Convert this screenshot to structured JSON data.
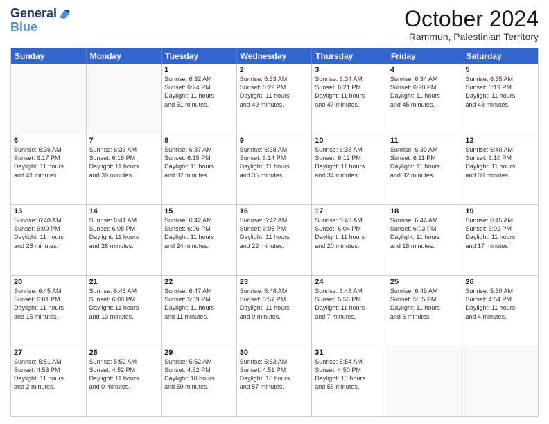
{
  "logo": {
    "line1": "General",
    "line2": "Blue"
  },
  "title": "October 2024",
  "location": "Rammun, Palestinian Territory",
  "days_of_week": [
    "Sunday",
    "Monday",
    "Tuesday",
    "Wednesday",
    "Thursday",
    "Friday",
    "Saturday"
  ],
  "weeks": [
    [
      {
        "day": "",
        "lines": [],
        "empty": true
      },
      {
        "day": "",
        "lines": [],
        "empty": true
      },
      {
        "day": "1",
        "lines": [
          "Sunrise: 6:32 AM",
          "Sunset: 6:24 PM",
          "Daylight: 11 hours",
          "and 51 minutes."
        ]
      },
      {
        "day": "2",
        "lines": [
          "Sunrise: 6:33 AM",
          "Sunset: 6:22 PM",
          "Daylight: 11 hours",
          "and 49 minutes."
        ]
      },
      {
        "day": "3",
        "lines": [
          "Sunrise: 6:34 AM",
          "Sunset: 6:21 PM",
          "Daylight: 11 hours",
          "and 47 minutes."
        ]
      },
      {
        "day": "4",
        "lines": [
          "Sunrise: 6:34 AM",
          "Sunset: 6:20 PM",
          "Daylight: 11 hours",
          "and 45 minutes."
        ]
      },
      {
        "day": "5",
        "lines": [
          "Sunrise: 6:35 AM",
          "Sunset: 6:19 PM",
          "Daylight: 11 hours",
          "and 43 minutes."
        ]
      }
    ],
    [
      {
        "day": "6",
        "lines": [
          "Sunrise: 6:36 AM",
          "Sunset: 6:17 PM",
          "Daylight: 11 hours",
          "and 41 minutes."
        ]
      },
      {
        "day": "7",
        "lines": [
          "Sunrise: 6:36 AM",
          "Sunset: 6:16 PM",
          "Daylight: 11 hours",
          "and 39 minutes."
        ]
      },
      {
        "day": "8",
        "lines": [
          "Sunrise: 6:37 AM",
          "Sunset: 6:15 PM",
          "Daylight: 11 hours",
          "and 37 minutes."
        ]
      },
      {
        "day": "9",
        "lines": [
          "Sunrise: 6:38 AM",
          "Sunset: 6:14 PM",
          "Daylight: 11 hours",
          "and 35 minutes."
        ]
      },
      {
        "day": "10",
        "lines": [
          "Sunrise: 6:38 AM",
          "Sunset: 6:12 PM",
          "Daylight: 11 hours",
          "and 34 minutes."
        ]
      },
      {
        "day": "11",
        "lines": [
          "Sunrise: 6:39 AM",
          "Sunset: 6:11 PM",
          "Daylight: 11 hours",
          "and 32 minutes."
        ]
      },
      {
        "day": "12",
        "lines": [
          "Sunrise: 6:40 AM",
          "Sunset: 6:10 PM",
          "Daylight: 11 hours",
          "and 30 minutes."
        ]
      }
    ],
    [
      {
        "day": "13",
        "lines": [
          "Sunrise: 6:40 AM",
          "Sunset: 6:09 PM",
          "Daylight: 11 hours",
          "and 28 minutes."
        ]
      },
      {
        "day": "14",
        "lines": [
          "Sunrise: 6:41 AM",
          "Sunset: 6:08 PM",
          "Daylight: 11 hours",
          "and 26 minutes."
        ]
      },
      {
        "day": "15",
        "lines": [
          "Sunrise: 6:42 AM",
          "Sunset: 6:06 PM",
          "Daylight: 11 hours",
          "and 24 minutes."
        ]
      },
      {
        "day": "16",
        "lines": [
          "Sunrise: 6:42 AM",
          "Sunset: 6:05 PM",
          "Daylight: 11 hours",
          "and 22 minutes."
        ]
      },
      {
        "day": "17",
        "lines": [
          "Sunrise: 6:43 AM",
          "Sunset: 6:04 PM",
          "Daylight: 11 hours",
          "and 20 minutes."
        ]
      },
      {
        "day": "18",
        "lines": [
          "Sunrise: 6:44 AM",
          "Sunset: 6:03 PM",
          "Daylight: 11 hours",
          "and 18 minutes."
        ]
      },
      {
        "day": "19",
        "lines": [
          "Sunrise: 6:45 AM",
          "Sunset: 6:02 PM",
          "Daylight: 11 hours",
          "and 17 minutes."
        ]
      }
    ],
    [
      {
        "day": "20",
        "lines": [
          "Sunrise: 6:45 AM",
          "Sunset: 6:01 PM",
          "Daylight: 11 hours",
          "and 15 minutes."
        ]
      },
      {
        "day": "21",
        "lines": [
          "Sunrise: 6:46 AM",
          "Sunset: 6:00 PM",
          "Daylight: 11 hours",
          "and 13 minutes."
        ]
      },
      {
        "day": "22",
        "lines": [
          "Sunrise: 6:47 AM",
          "Sunset: 5:59 PM",
          "Daylight: 11 hours",
          "and 11 minutes."
        ]
      },
      {
        "day": "23",
        "lines": [
          "Sunrise: 6:48 AM",
          "Sunset: 5:57 PM",
          "Daylight: 11 hours",
          "and 9 minutes."
        ]
      },
      {
        "day": "24",
        "lines": [
          "Sunrise: 6:48 AM",
          "Sunset: 5:56 PM",
          "Daylight: 11 hours",
          "and 7 minutes."
        ]
      },
      {
        "day": "25",
        "lines": [
          "Sunrise: 6:49 AM",
          "Sunset: 5:55 PM",
          "Daylight: 11 hours",
          "and 6 minutes."
        ]
      },
      {
        "day": "26",
        "lines": [
          "Sunrise: 5:50 AM",
          "Sunset: 4:54 PM",
          "Daylight: 11 hours",
          "and 4 minutes."
        ]
      }
    ],
    [
      {
        "day": "27",
        "lines": [
          "Sunrise: 5:51 AM",
          "Sunset: 4:53 PM",
          "Daylight: 11 hours",
          "and 2 minutes."
        ]
      },
      {
        "day": "28",
        "lines": [
          "Sunrise: 5:52 AM",
          "Sunset: 4:52 PM",
          "Daylight: 11 hours",
          "and 0 minutes."
        ]
      },
      {
        "day": "29",
        "lines": [
          "Sunrise: 5:52 AM",
          "Sunset: 4:52 PM",
          "Daylight: 10 hours",
          "and 59 minutes."
        ]
      },
      {
        "day": "30",
        "lines": [
          "Sunrise: 5:53 AM",
          "Sunset: 4:51 PM",
          "Daylight: 10 hours",
          "and 57 minutes."
        ]
      },
      {
        "day": "31",
        "lines": [
          "Sunrise: 5:54 AM",
          "Sunset: 4:50 PM",
          "Daylight: 10 hours",
          "and 55 minutes."
        ]
      },
      {
        "day": "",
        "lines": [],
        "empty": true
      },
      {
        "day": "",
        "lines": [],
        "empty": true
      }
    ]
  ]
}
